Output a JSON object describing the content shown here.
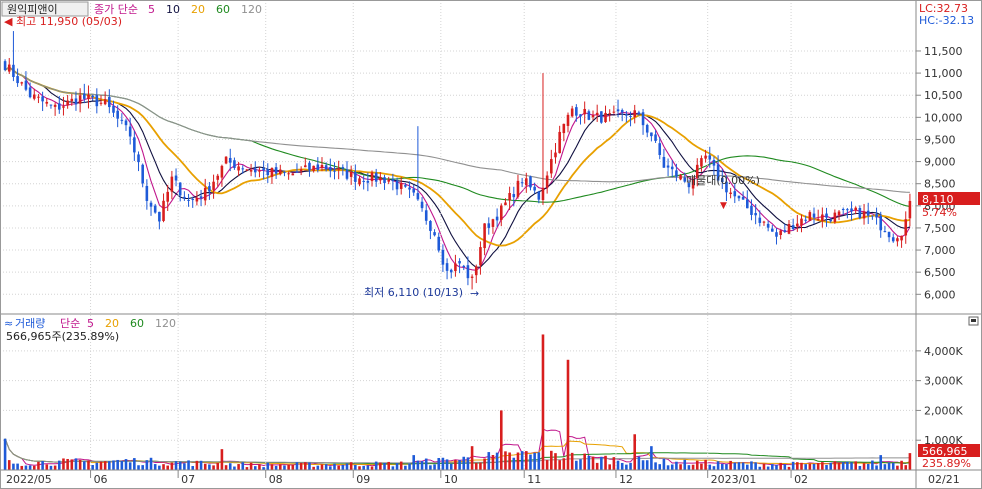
{
  "price_panel": {
    "stock_name": "원익피앤이",
    "ma_label": "종가 단순",
    "ma_periods": [
      "5",
      "10",
      "20",
      "60",
      "120"
    ],
    "ma_colors": [
      "#c0168c",
      "#101040",
      "#e8a000",
      "#1f8a1f",
      "#909090"
    ],
    "high_annotation": "최고 11,950 (05/03)",
    "low_annotation": "최저 6,110 (10/13)",
    "avg_price_annotation": "매물대(0.00%)",
    "lc_label": "LC:32.73",
    "hc_label": "HC:-32.13",
    "last_price_label": "8,110",
    "change_label": "5.74%"
  },
  "volume_panel": {
    "title": "거래량",
    "ma_label": "단순",
    "ma_periods": [
      "5",
      "20",
      "60",
      "120"
    ],
    "ma_colors": [
      "#c0168c",
      "#e8a000",
      "#1f8a1f",
      "#909090"
    ],
    "last_volume_text": "566,965주(235.89%)",
    "last_volume_label": "566,965",
    "last_volume_pct_label": "235.89%"
  },
  "x_axis_labels": [
    "2022/05",
    "06",
    "07",
    "08",
    "09",
    "10",
    "11",
    "12",
    "2023/01",
    "02",
    "02/21"
  ],
  "colors": {
    "up": "#d81e1e",
    "down": "#1e5ad8",
    "label_box_bg": "#d81e1e",
    "axis_text": "#333333",
    "grid": "#d4d4d4"
  },
  "chart_data": [
    {
      "type": "candlestick",
      "title": "",
      "ylim": [
        5600,
        12200
      ],
      "y_ticks": [
        6000,
        6500,
        7000,
        7500,
        8000,
        8500,
        9000,
        9500,
        10000,
        10500,
        11000,
        11500
      ],
      "y_tick_labels": [
        "6,000",
        "6,500",
        "7,000",
        "7,500",
        "8,000",
        "8,500",
        "9,000",
        "9,500",
        "10,000",
        "10,500",
        "11,000",
        "11,500"
      ],
      "months": [
        "2022/05",
        "06",
        "07",
        "08",
        "09",
        "10",
        "11",
        "12",
        "2023/01",
        "02",
        "02/21"
      ],
      "close_anchors": [
        [
          0,
          11200
        ],
        [
          6,
          10500
        ],
        [
          12,
          10200
        ],
        [
          18,
          10450
        ],
        [
          24,
          10300
        ],
        [
          30,
          9600
        ],
        [
          34,
          8200
        ],
        [
          37,
          7700
        ],
        [
          40,
          8600
        ],
        [
          44,
          8100
        ],
        [
          48,
          8300
        ],
        [
          53,
          9000
        ],
        [
          60,
          8800
        ],
        [
          68,
          8700
        ],
        [
          76,
          8900
        ],
        [
          84,
          8650
        ],
        [
          92,
          8600
        ],
        [
          98,
          8200
        ],
        [
          103,
          7400
        ],
        [
          106,
          6500
        ],
        [
          109,
          6700
        ],
        [
          112,
          6300
        ],
        [
          115,
          7500
        ],
        [
          119,
          7900
        ],
        [
          124,
          8600
        ],
        [
          128,
          8200
        ],
        [
          133,
          9600
        ],
        [
          136,
          10200
        ],
        [
          141,
          10000
        ],
        [
          146,
          10000
        ],
        [
          151,
          10100
        ],
        [
          155,
          9600
        ],
        [
          158,
          8900
        ],
        [
          161,
          8700
        ],
        [
          164,
          8500
        ],
        [
          168,
          9100
        ],
        [
          172,
          8500
        ],
        [
          176,
          8100
        ],
        [
          180,
          7800
        ],
        [
          185,
          7300
        ],
        [
          189,
          7600
        ],
        [
          193,
          7800
        ],
        [
          197,
          7750
        ],
        [
          201,
          7800
        ],
        [
          205,
          7850
        ],
        [
          208,
          7700
        ],
        [
          211,
          7500
        ],
        [
          213,
          7300
        ],
        [
          215,
          7450
        ],
        [
          216,
          7670
        ],
        [
          217,
          8110
        ]
      ],
      "ma_series_names": [
        "5",
        "10",
        "20",
        "60",
        "120"
      ],
      "high": {
        "value": 11950,
        "date": "05/03"
      },
      "low": {
        "value": 6110,
        "date": "10/13"
      },
      "last_close": 8110,
      "last_change_pct": 5.74
    },
    {
      "type": "bar",
      "title": "거래량",
      "ylim": [
        0,
        4700
      ],
      "y_ticks": [
        1000,
        2000,
        3000,
        4000
      ],
      "y_tick_labels": [
        "1,000K",
        "2,000K",
        "3,000K",
        "4,000K"
      ],
      "unit": "K shares",
      "spikes": [
        [
          0,
          1050
        ],
        [
          52,
          700
        ],
        [
          98,
          500
        ],
        [
          112,
          800
        ],
        [
          119,
          2000
        ],
        [
          129,
          4550
        ],
        [
          135,
          3700
        ],
        [
          141,
          450
        ],
        [
          151,
          1200
        ],
        [
          155,
          800
        ],
        [
          210,
          500
        ],
        [
          217,
          567
        ]
      ],
      "base_volume": [
        [
          0,
          250
        ],
        [
          30,
          320
        ],
        [
          60,
          180
        ],
        [
          95,
          220
        ],
        [
          110,
          380
        ],
        [
          125,
          550
        ],
        [
          140,
          420
        ],
        [
          160,
          260
        ],
        [
          190,
          200
        ],
        [
          210,
          240
        ],
        [
          217,
          300
        ]
      ],
      "last_volume": 566965,
      "last_volume_pct": 235.89
    }
  ]
}
